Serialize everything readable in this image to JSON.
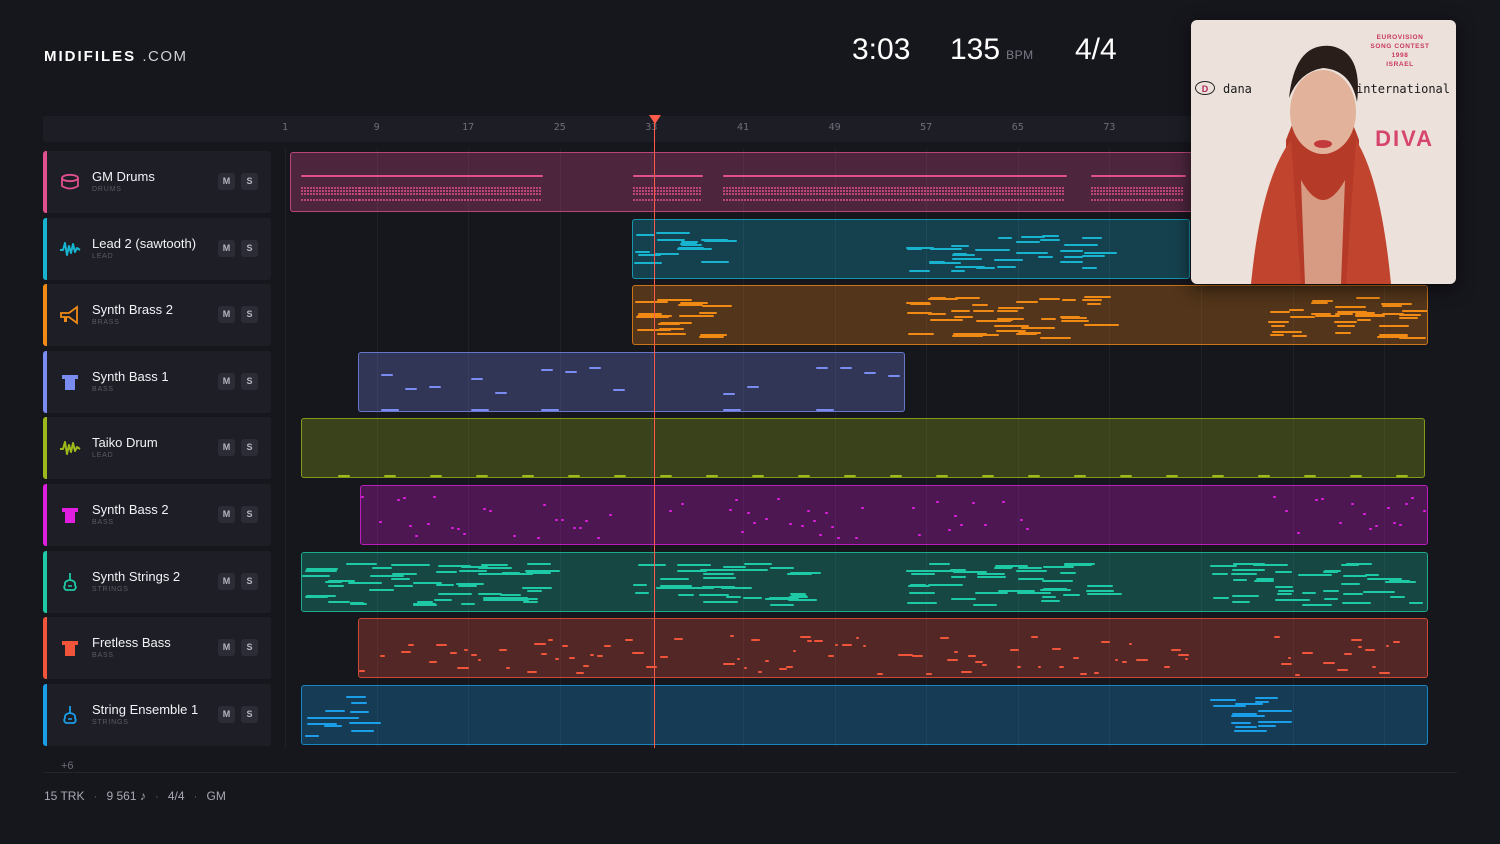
{
  "brand": {
    "name": "MIDIFILES",
    "domain": ".COM"
  },
  "header": {
    "time": "3:03",
    "bpm": "135",
    "bpm_unit": "BPM",
    "signature": "4/4"
  },
  "ruler": {
    "labels": [
      "1",
      "9",
      "17",
      "25",
      "33",
      "41",
      "49",
      "57",
      "65",
      "73"
    ]
  },
  "tracks": [
    {
      "name": "GM Drums",
      "category": "DRUMS",
      "color": "#e0508f",
      "icon": "drum-icon",
      "mute": "M",
      "solo": "S"
    },
    {
      "name": "Lead 2 (sawtooth)",
      "category": "LEAD",
      "color": "#17b3cf",
      "icon": "waveform-icon",
      "mute": "M",
      "solo": "S"
    },
    {
      "name": "Synth Brass 2",
      "category": "BRASS",
      "color": "#f08a14",
      "icon": "trumpet-icon",
      "mute": "M",
      "solo": "S"
    },
    {
      "name": "Synth Bass 1",
      "category": "BASS",
      "color": "#7a8cf0",
      "icon": "bass-icon",
      "mute": "M",
      "solo": "S"
    },
    {
      "name": "Taiko Drum",
      "category": "LEAD",
      "color": "#9cb81a",
      "icon": "waveform-icon",
      "mute": "M",
      "solo": "S"
    },
    {
      "name": "Synth Bass 2",
      "category": "BASS",
      "color": "#e01ee0",
      "icon": "bass-icon",
      "mute": "M",
      "solo": "S"
    },
    {
      "name": "Synth Strings 2",
      "category": "STRINGS",
      "color": "#1ec9a5",
      "icon": "violin-icon",
      "mute": "M",
      "solo": "S"
    },
    {
      "name": "Fretless Bass",
      "category": "BASS",
      "color": "#f0553c",
      "icon": "bass-icon",
      "mute": "M",
      "solo": "S"
    },
    {
      "name": "String Ensemble 1",
      "category": "STRINGS",
      "color": "#1a9ee8",
      "icon": "violin-icon",
      "mute": "M",
      "solo": "S"
    }
  ],
  "more_tracks": "+6",
  "footer": {
    "tracks": "15 TRK",
    "notes": "9 561 ♪",
    "signature": "4/4",
    "standard": "GM"
  },
  "album": {
    "contest_lines": [
      "EUROVISION",
      "SONG CONTEST",
      "1998",
      "ISRAEL"
    ],
    "artist_left": "dana",
    "artist_right": "international",
    "title": "DIVA",
    "logo_letter": "D"
  }
}
